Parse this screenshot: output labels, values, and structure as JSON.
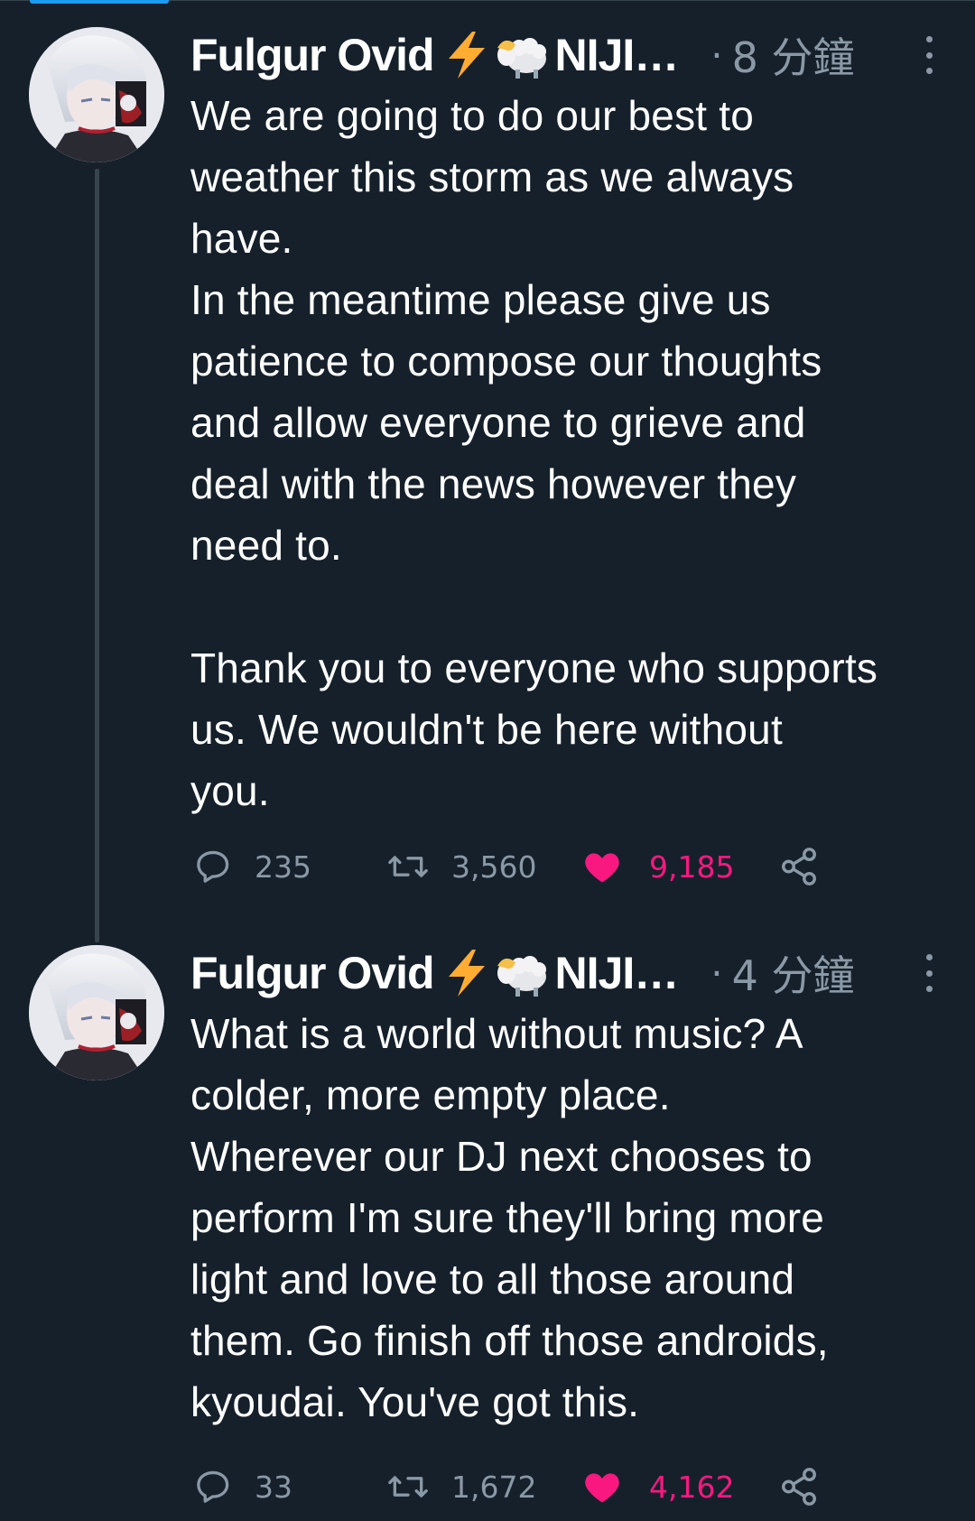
{
  "colors": {
    "background": "#15202b",
    "text": "#ffffff",
    "muted": "#8b98a5",
    "like": "#f91880",
    "accent": "#1d9bf0"
  },
  "tweets": [
    {
      "display_name": "Fulgur Ovid",
      "badge_icons": [
        "lightning-emoji",
        "ram-emoji"
      ],
      "name_suffix": "NIJI…",
      "dot": "·",
      "timestamp": "8 分鐘",
      "text": "We are going to do our best to\nweather this storm as we always\nhave.\nIn the meantime please give us\npatience to compose our thoughts\nand allow everyone to grieve and\ndeal with the news however they\nneed to.\n\nThank you to everyone who supports\nus. We wouldn't be here without\nyou.",
      "reply_count": "235",
      "retweet_count": "3,560",
      "like_count": "9,185",
      "liked": true
    },
    {
      "display_name": "Fulgur Ovid",
      "badge_icons": [
        "lightning-emoji",
        "ram-emoji"
      ],
      "name_suffix": "NIJI…",
      "dot": "·",
      "timestamp": "4 分鐘",
      "text": "What is a world without music? A\ncolder, more empty place.\nWherever our DJ next chooses to\nperform I'm sure they'll bring more\nlight and love to all those around\nthem. Go finish off those androids,\nkyoudai. You've got this.",
      "reply_count": "33",
      "retweet_count": "1,672",
      "like_count": "4,162",
      "liked": true
    }
  ]
}
